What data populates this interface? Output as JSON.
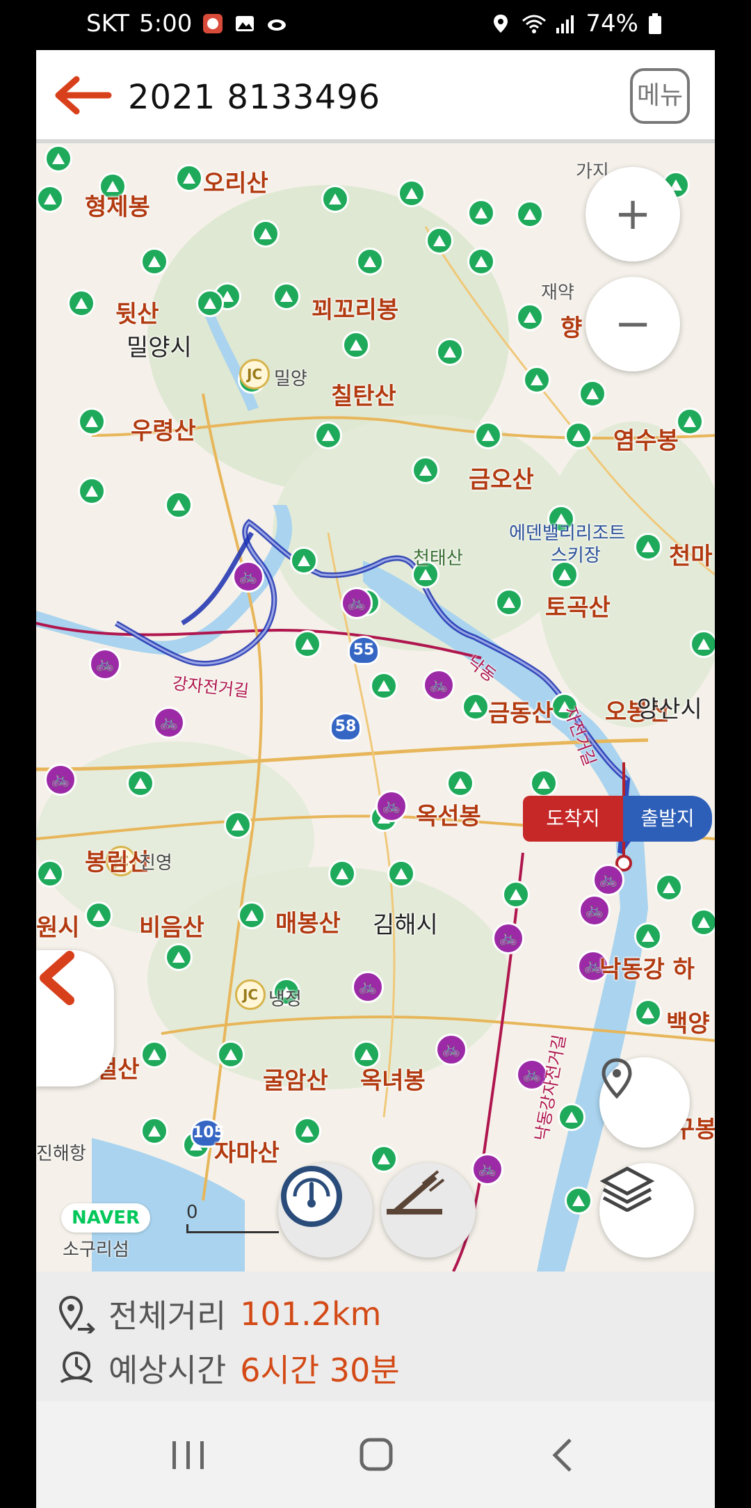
{
  "status_bar": {
    "carrier": "SKT",
    "time": "5:00",
    "battery": "74%"
  },
  "header": {
    "title": "2021 8133496",
    "menu_label": "메뉴"
  },
  "map": {
    "provider": "NAVER",
    "scale_zero": "0",
    "places": [
      "형제봉",
      "오리산",
      "뒷산",
      "꾀꼬리봉",
      "칠탄산",
      "우령산",
      "금오산",
      "염수봉",
      "토곡산",
      "천마",
      "금동산",
      "오봉산",
      "옥선봉",
      "봉림산",
      "비음산",
      "매봉산",
      "굴암산",
      "옥녀봉",
      "자마산",
      "낙동강 하",
      "백양",
      "구봉"
    ],
    "cities": [
      "밀양시",
      "김해시",
      "양산시"
    ],
    "small_labels": [
      "에덴밸리리조트",
      "스키장",
      "천태산",
      "가지",
      "재약",
      "향",
      "밀양",
      "진영",
      "냉정",
      "소구리섬",
      "진해항",
      "원시",
      "철산"
    ],
    "jc_labels": [
      "JC",
      "JC",
      "JC"
    ],
    "road_labels": [
      "강자전거길",
      "낙동",
      "자전거길",
      "낙동강자전거길"
    ],
    "highway_numbers": [
      "58",
      "55",
      "105"
    ],
    "flag_end": "도착지",
    "flag_start": "출발지",
    "buttons": {
      "zoom_in": "+",
      "zoom_out": "−"
    },
    "colors": {
      "route": "#1a2fb0",
      "road": "#b0164e",
      "water": "#a9d3ee",
      "forest": "#dfe8d3",
      "mountain": "#1eaa5a",
      "bike": "#9c2aa6"
    }
  },
  "summary": {
    "distance_label": "전체거리",
    "distance_value": "101.2km",
    "time_label": "예상시간",
    "time_value": "6시간 30분"
  }
}
